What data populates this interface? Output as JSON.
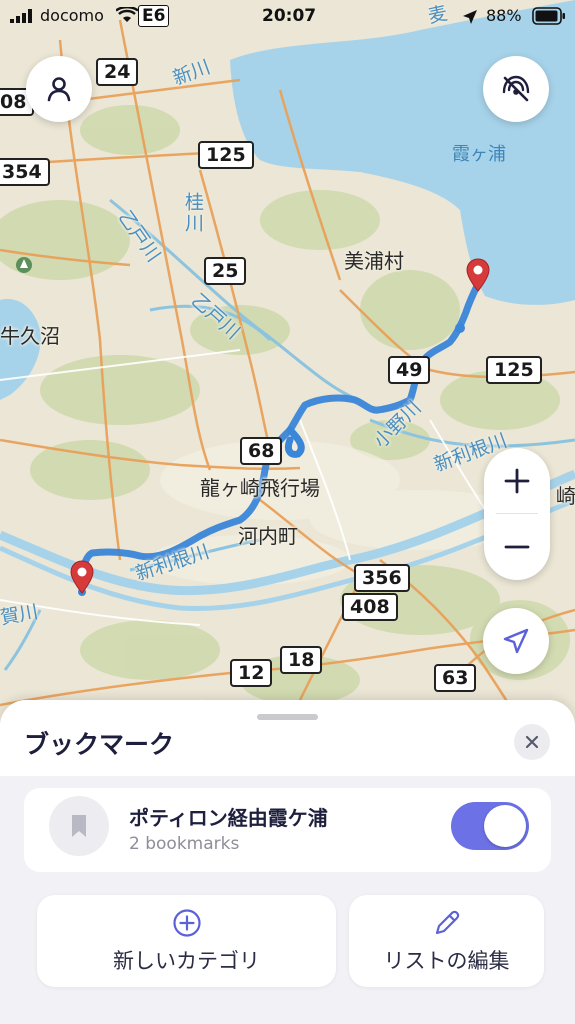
{
  "status_bar": {
    "carrier": "docomo",
    "network": "E6",
    "time": "20:07",
    "battery": "88%"
  },
  "map": {
    "places": [
      "美浦村",
      "龍ヶ崎飛行場",
      "河内町",
      "牛久沼"
    ],
    "water": [
      "霞ヶ浦"
    ],
    "rivers": [
      "新川",
      "桂川",
      "乙戸川",
      "乙戸川",
      "小野川",
      "新利根川",
      "新利根川",
      "賀川",
      "新川"
    ],
    "edge_labels": [
      "麦",
      "崎"
    ],
    "route_shields": [
      "24",
      "08",
      "354",
      "125",
      "25",
      "49",
      "125",
      "68",
      "356",
      "408",
      "12",
      "18",
      "63"
    ]
  },
  "controls": {
    "profile_icon": "person-icon",
    "gps_off_icon": "location-off-icon",
    "zoom_in": "+",
    "zoom_out": "−",
    "locate_icon": "navigation-arrow-icon"
  },
  "sheet": {
    "title": "ブックマーク",
    "list": {
      "name": "ポティロン経由霞ケ浦",
      "count": "2 bookmarks",
      "visible": true
    },
    "actions": {
      "new_category": "新しいカテゴリ",
      "edit_list": "リストの編集"
    }
  },
  "colors": {
    "route": "#3a86d8",
    "pin": "#d63a3a",
    "toggle_on": "#6c72e6",
    "accent_icon": "#5b61d8",
    "water": "#a7d3ea"
  }
}
